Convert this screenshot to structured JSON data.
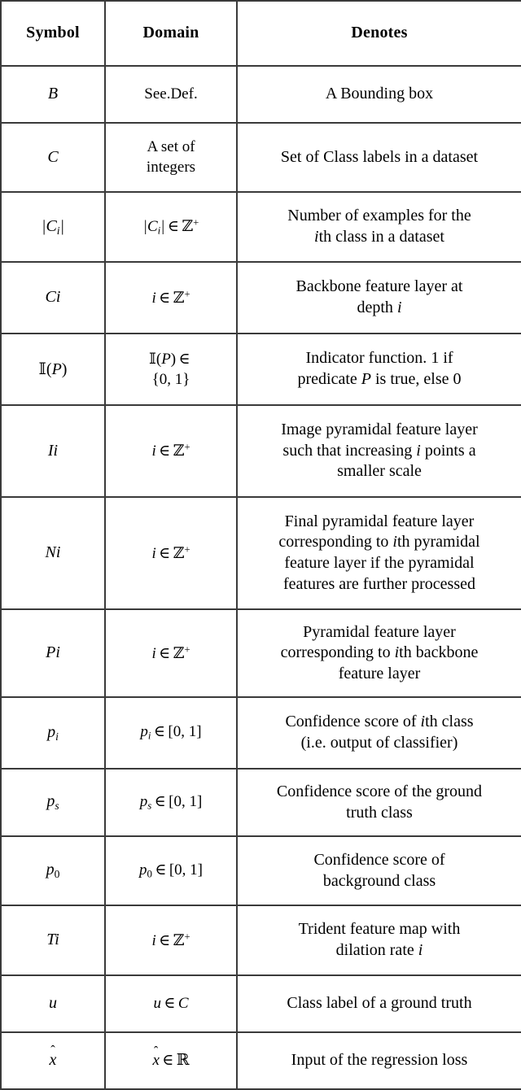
{
  "table": {
    "name": "notation-table",
    "columns": [
      {
        "key": "symbol",
        "label": "Symbol"
      },
      {
        "key": "domain",
        "label": "Domain"
      },
      {
        "key": "denotes",
        "label": "Denotes"
      }
    ],
    "rows": [
      {
        "symbol_plain": "B",
        "domain_plain": "See.Def.",
        "denotes_plain": "A Bounding box"
      },
      {
        "symbol_plain": "C",
        "domain_plain": "A set of integers",
        "domain_line1": "A set of",
        "domain_line2": "integers",
        "denotes_plain": "Set of Class labels in a dataset"
      },
      {
        "symbol_plain": "|C_i|",
        "domain_plain": "|C_i| ∈ Z+",
        "denotes_plain": "Number of examples for the ith class in a dataset",
        "denotes_line1_a": "Number of examples for the",
        "denotes_line2_i": "i",
        "denotes_line2_b": "th class in a dataset"
      },
      {
        "symbol_plain": "Ci",
        "domain_plain": "i ∈ Z+",
        "denotes_line1": "Backbone feature layer at",
        "denotes_line2_a": "depth ",
        "denotes_line2_i": "i"
      },
      {
        "symbol_plain": "I(P)",
        "domain_plain": "I(P) ∈ {0, 1}",
        "denotes_line1_a": "Indicator function. ",
        "denotes_line1_num": "1",
        "denotes_line1_b": " if",
        "denotes_line2_a": "predicate ",
        "denotes_line2_p": "P",
        "denotes_line2_b": " is true, else ",
        "denotes_line2_num": "0"
      },
      {
        "symbol_plain": "Ii",
        "domain_plain": "i ∈ Z+",
        "denotes_line1": "Image pyramidal feature layer",
        "denotes_line2_a": "such that increasing ",
        "denotes_line2_i": "i",
        "denotes_line2_b": " points a",
        "denotes_line3": "smaller scale"
      },
      {
        "symbol_plain": "Ni",
        "domain_plain": "i ∈ Z+",
        "denotes_line1": "Final pyramidal feature layer",
        "denotes_line2_a": "corresponding to ",
        "denotes_line2_i": "i",
        "denotes_line2_b": "th pyramidal",
        "denotes_line3": "feature layer if the pyramidal",
        "denotes_line4": "features are further processed"
      },
      {
        "symbol_plain": "Pi",
        "domain_plain": "i ∈ Z+",
        "denotes_line1": "Pyramidal feature layer",
        "denotes_line2_a": "corresponding to ",
        "denotes_line2_i": "i",
        "denotes_line2_b": "th backbone",
        "denotes_line3": "feature layer"
      },
      {
        "symbol_plain": "p_i",
        "domain_plain": "p_i ∈ [0, 1]",
        "denotes_line1_a": "Confidence score of ",
        "denotes_line1_i": "i",
        "denotes_line1_b": "th class",
        "denotes_line2": "(i.e. output of classifier)"
      },
      {
        "symbol_plain": "p_s",
        "domain_plain": "p_s ∈ [0, 1]",
        "denotes_line1": "Confidence score of the ground",
        "denotes_line2": "truth class"
      },
      {
        "symbol_plain": "p_0",
        "domain_plain": "p_0 ∈ [0, 1]",
        "denotes_line1": "Confidence score of",
        "denotes_line2": "background class"
      },
      {
        "symbol_plain": "Ti",
        "domain_plain": "i ∈ Z+",
        "denotes_line1": "Trident feature map with",
        "denotes_line2_a": "dilation rate ",
        "denotes_line2_i": "i"
      },
      {
        "symbol_plain": "u",
        "domain_plain": "u ∈ C",
        "denotes_plain": "Class label of a ground truth"
      },
      {
        "symbol_plain": "x̂",
        "domain_plain": "x̂ ∈ R",
        "denotes_plain": "Input of the regression loss"
      }
    ]
  },
  "glyphs": {
    "element_of": "∈",
    "blackboard_z": "ℤ",
    "blackboard_r": "ℝ",
    "blackboard_i": "𝕀",
    "hat_mark": "ˆ",
    "plus": "+"
  },
  "style": {
    "border_color": "#3a3a3a",
    "text_color": "#000000",
    "background": "#ffffff"
  }
}
